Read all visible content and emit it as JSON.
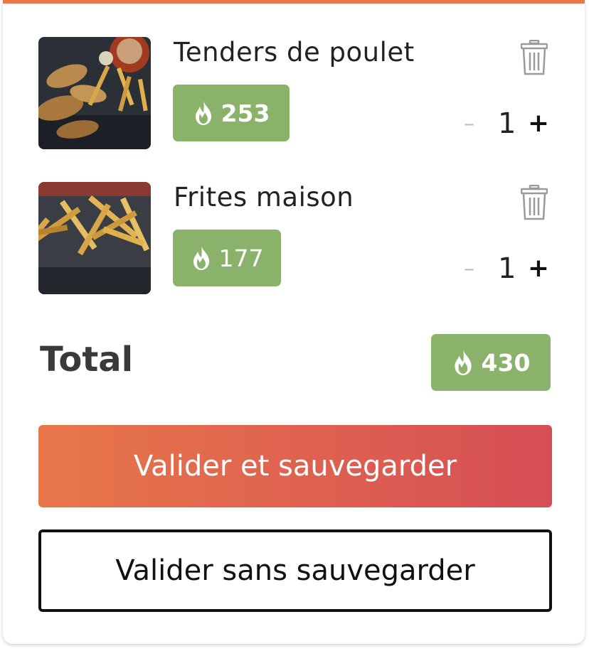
{
  "cart": {
    "items": [
      {
        "name": "Tenders de poulet",
        "calories": "253",
        "quantity": "1",
        "minus_label": "–",
        "plus_label": "+",
        "image_icon": "chicken-tenders-image"
      },
      {
        "name": "Frites maison",
        "calories": "177",
        "quantity": "1",
        "minus_label": "–",
        "plus_label": "+",
        "image_icon": "fries-image"
      }
    ],
    "total_label": "Total",
    "total_calories": "430"
  },
  "actions": {
    "validate_save_label": "Valider et sauvegarder",
    "validate_no_save_label": "Valider sans sauvegarder"
  },
  "colors": {
    "accent_top": "#e8774a",
    "gradient_start": "#e8774a",
    "gradient_end": "#d64e55",
    "calorie_badge": "#8bb26a"
  },
  "icons": {
    "calorie": "flame-icon",
    "delete": "trash-icon"
  }
}
